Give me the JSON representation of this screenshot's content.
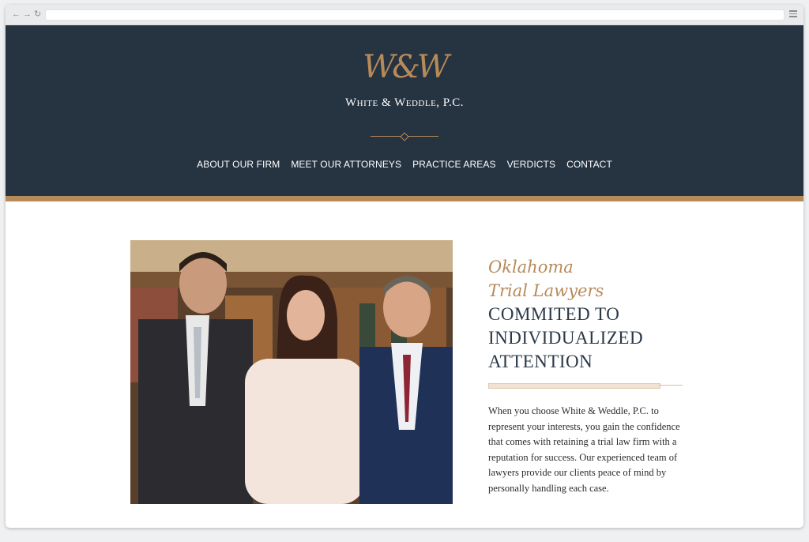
{
  "browser": {
    "back_icon": "←",
    "forward_icon": "→",
    "reload_icon": "↻"
  },
  "header": {
    "monogram": "W&W",
    "firm_name": "White & Weddle, P.C.",
    "colors": {
      "background": "#263340",
      "accent": "#b78a5a"
    }
  },
  "nav": {
    "items": [
      {
        "label": "ABOUT OUR FIRM"
      },
      {
        "label": "MEET OUR ATTORNEYS"
      },
      {
        "label": "PRACTICE AREAS"
      },
      {
        "label": "VERDICTS"
      },
      {
        "label": "CONTACT"
      }
    ]
  },
  "hero": {
    "kicker_line1": "Oklahoma",
    "kicker_line2": "Trial Lawyers",
    "headline_line1": "COMMITED TO",
    "headline_line2": "INDIVIDUALIZED",
    "headline_line3": "ATTENTION",
    "body": "When you choose White & Weddle, P.C. to represent your interests, you gain the confidence that comes with retaining a trial law firm with a reputation for success. Our experienced team of lawyers provide our clients peace of mind by personally handling each case."
  }
}
